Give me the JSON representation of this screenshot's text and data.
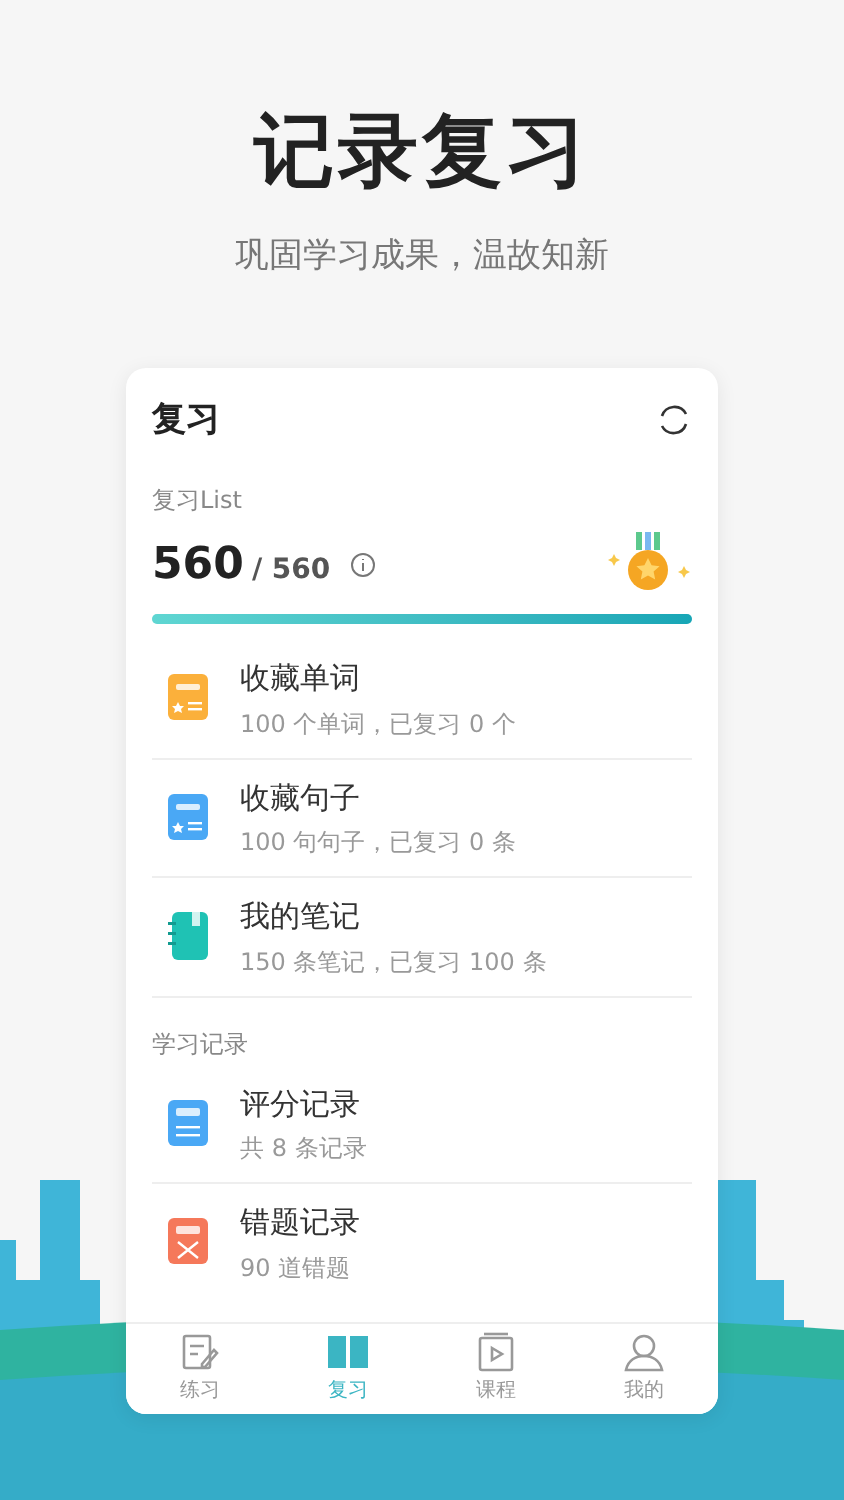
{
  "header": {
    "title": "记录复习",
    "subtitle": "巩固学习成果，温故知新"
  },
  "card": {
    "title": "复习",
    "section_label": "复习List",
    "count": "560",
    "total": "/ 560",
    "level": 1.0
  },
  "review_items": [
    {
      "kind": "words",
      "title": "收藏单词",
      "subtitle": "100 个单词，已复习 0 个"
    },
    {
      "kind": "sentences",
      "title": "收藏句子",
      "subtitle": "100 句句子，已复习 0 条"
    },
    {
      "kind": "notes",
      "title": "我的笔记",
      "subtitle": "150 条笔记，已复习 100 条"
    }
  ],
  "records_label": "学习记录",
  "record_items": [
    {
      "kind": "score",
      "title": "评分记录",
      "subtitle": "共 8 条记录"
    },
    {
      "kind": "mistakes",
      "title": "错题记录",
      "subtitle": "90 道错题"
    }
  ],
  "tabs": [
    {
      "kind": "practice",
      "label": "练习",
      "selected": false
    },
    {
      "kind": "review",
      "label": "复习",
      "selected": true
    },
    {
      "kind": "course",
      "label": "课程",
      "selected": false
    },
    {
      "kind": "me",
      "label": "我的",
      "selected": false
    }
  ]
}
